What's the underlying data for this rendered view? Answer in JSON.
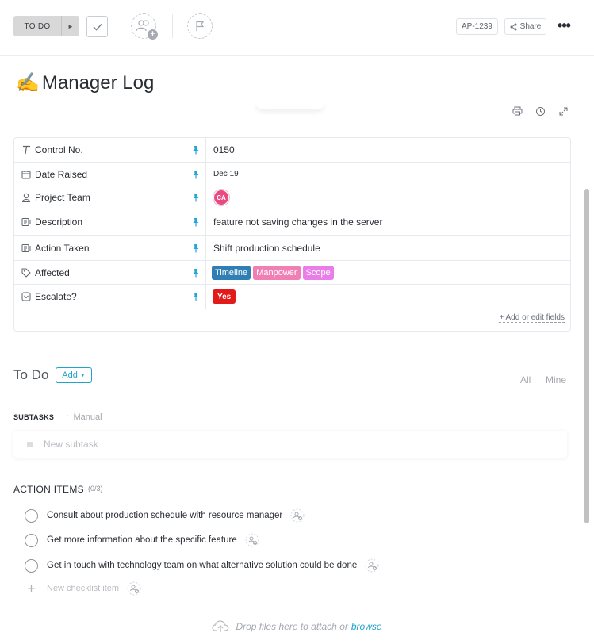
{
  "topbar": {
    "status_label": "TO DO",
    "task_id": "AP-1239",
    "share_label": "Share",
    "icons": {
      "status_arrow": "caret-right-icon",
      "complete": "checkmark-icon",
      "assignee": "add-assignee-icon",
      "priority": "flag-icon",
      "share": "share-icon",
      "more": "more-dots-icon"
    }
  },
  "task": {
    "emoji": "✍️",
    "title": "Manager Log"
  },
  "tools": {
    "icons": [
      "print-icon",
      "history-icon",
      "expand-icon"
    ]
  },
  "fields": [
    {
      "label": "Control No.",
      "icon": "text-field-icon",
      "value": "0150"
    },
    {
      "label": "Date Raised",
      "icon": "calendar-icon",
      "value": "Dec 19"
    },
    {
      "label": "Project Team",
      "icon": "person-icon",
      "avatar": "CA"
    },
    {
      "label": "Description",
      "icon": "long-text-icon",
      "value": "feature not saving changes in the server"
    },
    {
      "label": "Action Taken",
      "icon": "long-text-icon",
      "value": "Shift production schedule"
    },
    {
      "label": "Affected",
      "icon": "tag-icon",
      "tags": [
        {
          "label": "Timeline",
          "color": "#2f7fb5"
        },
        {
          "label": "Manpower",
          "color": "#f080b4"
        },
        {
          "label": "Scope",
          "color": "#ea7ee8"
        }
      ]
    },
    {
      "label": "Escalate?",
      "icon": "dropdown-icon",
      "badge": {
        "label": "Yes",
        "color": "#e31a1a"
      }
    }
  ],
  "fields_footer": {
    "add_edit_label": "+ Add or edit fields"
  },
  "todo": {
    "title": "To Do",
    "add_label": "Add",
    "filter_all": "All",
    "filter_mine": "Mine"
  },
  "subtasks": {
    "label": "SUBTASKS",
    "sort_label": "Manual",
    "new_placeholder": "New subtask"
  },
  "action_items": {
    "label": "ACTION ITEMS",
    "count": "(0/3)",
    "items": [
      "Consult about production schedule with resource manager",
      "Get more information about the specific feature",
      "Get in touch with technology team on what alternative solution could be done"
    ],
    "new_placeholder": "New checklist item"
  },
  "dropzone": {
    "text": "Drop files here to attach or",
    "browse": "browse"
  },
  "colors": {
    "accent": "#1ea3c9",
    "pin": "#22a8d8",
    "avatar": "#ea4a82"
  }
}
